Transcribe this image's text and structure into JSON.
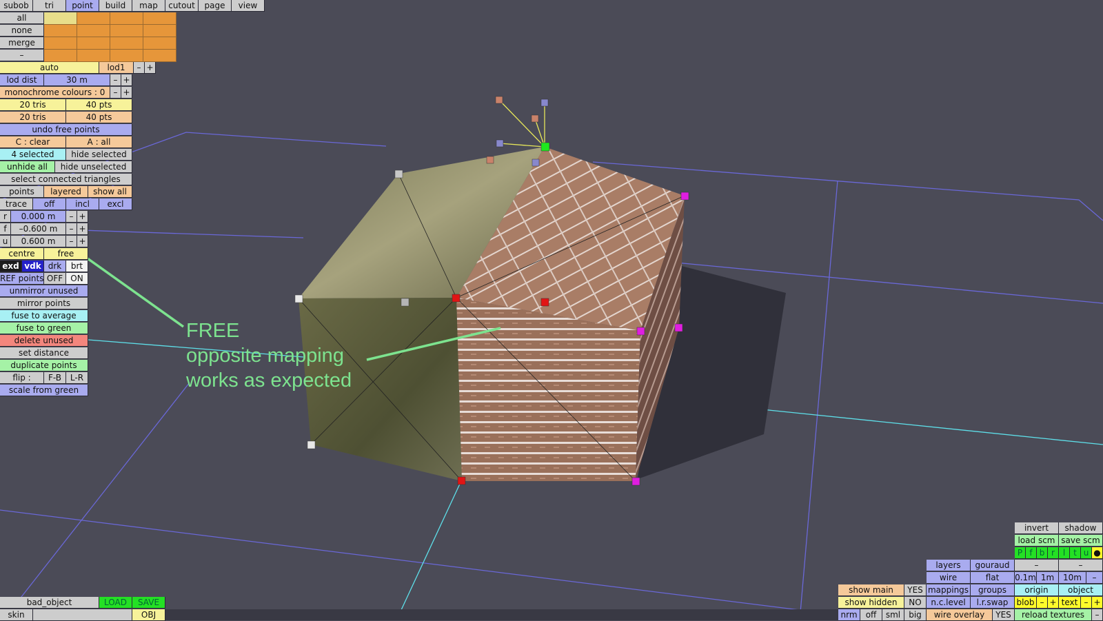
{
  "menu": [
    "subob",
    "tri",
    "point",
    "build",
    "map",
    "cutout",
    "page",
    "view"
  ],
  "select_rows": [
    "all",
    "none",
    "merge",
    "–"
  ],
  "lod": {
    "mode": "auto",
    "level": "lod1",
    "minus": "–",
    "plus": "+"
  },
  "lod_dist": {
    "label": "lod dist",
    "value": "30 m",
    "minus": "–",
    "plus": "+"
  },
  "mono": {
    "label": "monochrome colours : 0",
    "minus": "–",
    "plus": "+"
  },
  "counts": [
    {
      "tris": "20 tris",
      "pts": "40 pts"
    },
    {
      "tris": "20 tris",
      "pts": "40 pts"
    }
  ],
  "undo": "undo free points",
  "clear_all": {
    "clear": "C : clear",
    "all": "A : all"
  },
  "selection": {
    "selected": "4 selected",
    "hide_selected": "hide selected",
    "unhide_all": "unhide all",
    "hide_unselected": "hide unselected"
  },
  "select_connected": "select connected triangles",
  "view_mode": {
    "points": "points",
    "layered": "layered",
    "show_all": "show all"
  },
  "trace": {
    "label": "trace",
    "off": "off",
    "incl": "incl",
    "excl": "excl"
  },
  "coords": [
    {
      "axis": "r",
      "value": "0.000 m",
      "minus": "–",
      "plus": "+"
    },
    {
      "axis": "f",
      "value": "–0.600 m",
      "minus": "–",
      "plus": "+"
    },
    {
      "axis": "u",
      "value": "0.600 m",
      "minus": "–",
      "plus": "+"
    }
  ],
  "centre": {
    "label": "centre",
    "value": "free"
  },
  "shade": {
    "exd": "exd",
    "vdk": "vdk",
    "drk": "drk",
    "brt": "brt"
  },
  "ref_points": {
    "label": "REF points",
    "off": "OFF",
    "on": "ON"
  },
  "ops": [
    "unmirror unused",
    "mirror points",
    "fuse to average",
    "fuse to green",
    "delete unused",
    "set distance",
    "duplicate points"
  ],
  "flip": {
    "label": "flip :",
    "fb": "F-B",
    "lr": "L-R"
  },
  "scale": "scale from green",
  "annotation": {
    "line1": "FREE",
    "line2": "opposite mapping",
    "line3": "works as expected"
  },
  "file": {
    "name": "bad_object",
    "load": "LOAD",
    "save": "SAVE",
    "skin": "skin",
    "skin_value": "",
    "obj": "OBJ"
  },
  "right_panel": {
    "invert": "invert",
    "shadow": "shadow",
    "load_scm": "load scm",
    "save_scm": "save scm",
    "axes": [
      "P",
      "f",
      "b",
      "r",
      "l",
      "t",
      "u"
    ],
    "dot": "●",
    "layers": "layers",
    "gouraud": "gouraud",
    "dash1": "–",
    "dash2": "–",
    "wire": "wire",
    "flat": "flat",
    "s01": "0.1m",
    "s1": "1m",
    "s10": "10m",
    "sminus": "–",
    "show_main": "show main",
    "show_main_v": "YES",
    "mappings": "mappings",
    "groups": "groups",
    "origin": "origin",
    "object": "object",
    "show_hidden": "show hidden",
    "show_hidden_v": "NO",
    "nclevel": "n.c.level",
    "lrswap": "l.r.swap",
    "blob": "blob",
    "blob_minus": "–",
    "blob_plus": "+",
    "text": "text",
    "text_minus": "–",
    "text_plus": "+",
    "nrm": "nrm",
    "off": "off",
    "sml": "sml",
    "big": "big",
    "wire_overlay": "wire overlay",
    "wire_overlay_v": "YES",
    "reload": "reload textures",
    "reload_minus": "–"
  },
  "colors": {
    "background": "#4b4b57",
    "grid": "#6a68d8",
    "axis": "#5ee0ea",
    "annotation": "#7de38f",
    "selected_point": "#e11515",
    "green_point": "#1ee81e",
    "magenta_point": "#e01ee0"
  }
}
